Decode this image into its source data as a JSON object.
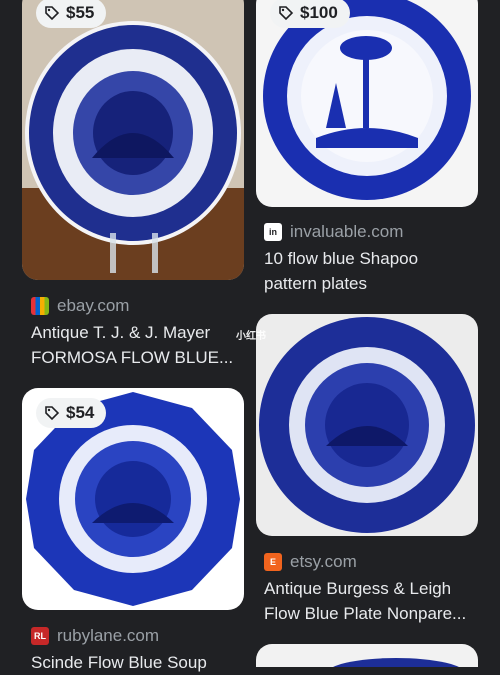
{
  "results": [
    {
      "price": "$55",
      "source": "ebay.com",
      "title_line1": "Antique T. J. & J. Mayer",
      "title_line2": "FORMOSA FLOW BLUE..."
    },
    {
      "price": "$100",
      "source": "invaluable.com",
      "title_line1": "10 flow blue Shapoo",
      "title_line2": "pattern plates"
    },
    {
      "price": "$54",
      "source": "rubylane.com",
      "title_line1": "Scinde Flow Blue Soup",
      "title_line2": ""
    },
    {
      "price": "",
      "source": "etsy.com",
      "title_line1": "Antique Burgess & Leigh",
      "title_line2": "Flow Blue Plate Nonpare..."
    }
  ],
  "watermark": "小红书",
  "icons": {
    "price_tag": "tag-icon",
    "ebay": "ebay-logo-icon",
    "invaluable": "invaluable-logo-icon",
    "rubylane": "rubylane-logo-icon",
    "etsy": "etsy-logo-icon"
  },
  "colors": {
    "background": "#202124",
    "text": "#e8eaed",
    "muted": "#9aa0a6",
    "price_chip": "#f1f3f4",
    "flow_blue": "#1a2fa0"
  }
}
